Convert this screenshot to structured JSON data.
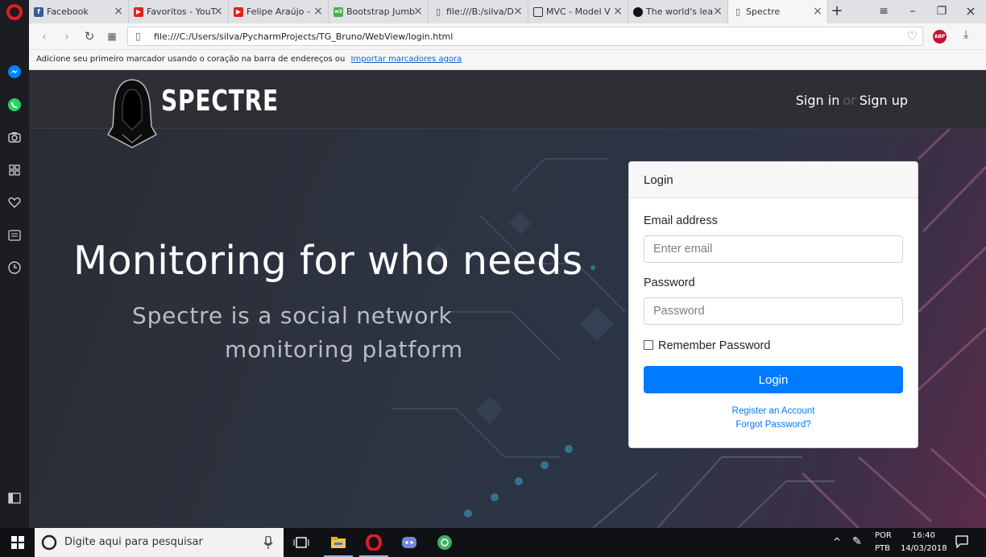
{
  "browser": {
    "tabs": [
      {
        "title": "Facebook",
        "favicon": "facebook-icon",
        "color": "#3b5998"
      },
      {
        "title": "Favoritos - YouT",
        "favicon": "youtube-icon",
        "color": "#e62117"
      },
      {
        "title": "Felipe Araújo - ",
        "favicon": "youtube-icon",
        "color": "#e62117"
      },
      {
        "title": "Bootstrap Jumb",
        "favicon": "w3schools-icon",
        "color": "#4caf50"
      },
      {
        "title": "file:///B:/silva/D",
        "favicon": "file-icon",
        "color": "#555555"
      },
      {
        "title": "MVC - Model V",
        "favicon": "page-icon",
        "color": "#333333"
      },
      {
        "title": "The world's lea",
        "favicon": "github-icon",
        "color": "#111111"
      },
      {
        "title": "Spectre",
        "favicon": "file-icon",
        "color": "#555555",
        "active": true
      }
    ],
    "url": "file:///C:/Users/silva/PycharmProjects/TG_Bruno/WebView/login.html",
    "bookmarks": {
      "message": "Adicione seu primeiro marcador usando o coração na barra de endereços ou",
      "link": "Importar marcadores agora"
    },
    "adblock_label": "ABP"
  },
  "site": {
    "brand": "SPECTRE",
    "nav": {
      "sign_in": "Sign in",
      "separator": "or",
      "sign_up": "Sign up"
    },
    "hero": {
      "title": "Monitoring for who needs",
      "subtitle_line1": "Spectre is a social network",
      "subtitle_line2": "monitoring platform"
    },
    "login": {
      "header": "Login",
      "email_label": "Email address",
      "email_placeholder": "Enter email",
      "password_label": "Password",
      "password_placeholder": "Password",
      "remember_label": "Remember Password",
      "button": "Login",
      "register_link": "Register an Account",
      "forgot_link": "Forgot Password?"
    }
  },
  "taskbar": {
    "search_placeholder": "Digite aqui para pesquisar",
    "language": "POR",
    "keyboard": "PTB",
    "time": "16:40",
    "date": "14/03/2018"
  },
  "colors": {
    "accent": "#007bff",
    "opera_red": "#e31b23"
  }
}
